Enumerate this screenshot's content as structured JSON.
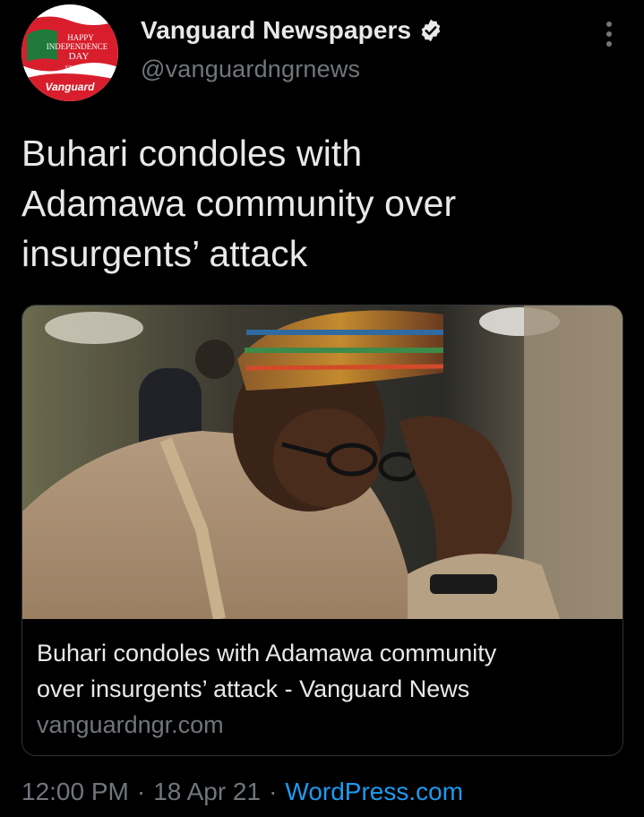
{
  "author": {
    "display_name": "Vanguard Newspapers",
    "handle": "@vanguardngrnews",
    "verified": true,
    "avatar_text": [
      "HAPPY",
      "INDEPENDENCE",
      "DAY",
      "FROM",
      "Vanguard"
    ]
  },
  "tweet": {
    "text": "Buhari condoles with\nAdamawa community over\ninsurgents’ attack"
  },
  "card": {
    "title": "Buhari condoles with Adamawa community\nover insurgents’ attack - Vanguard News",
    "domain": "vanguardngr.com",
    "image_icon": "news-photo"
  },
  "meta": {
    "time": "12:00 PM",
    "date": "18 Apr 21",
    "source": "WordPress.com"
  },
  "icons": {
    "verified": "verified-badge-icon",
    "more": "more-options-icon"
  },
  "colors": {
    "background": "#000000",
    "primary_text": "#e7e9ea",
    "secondary_text": "#71767b",
    "link": "#1d9bf0",
    "border": "#2f3336"
  }
}
